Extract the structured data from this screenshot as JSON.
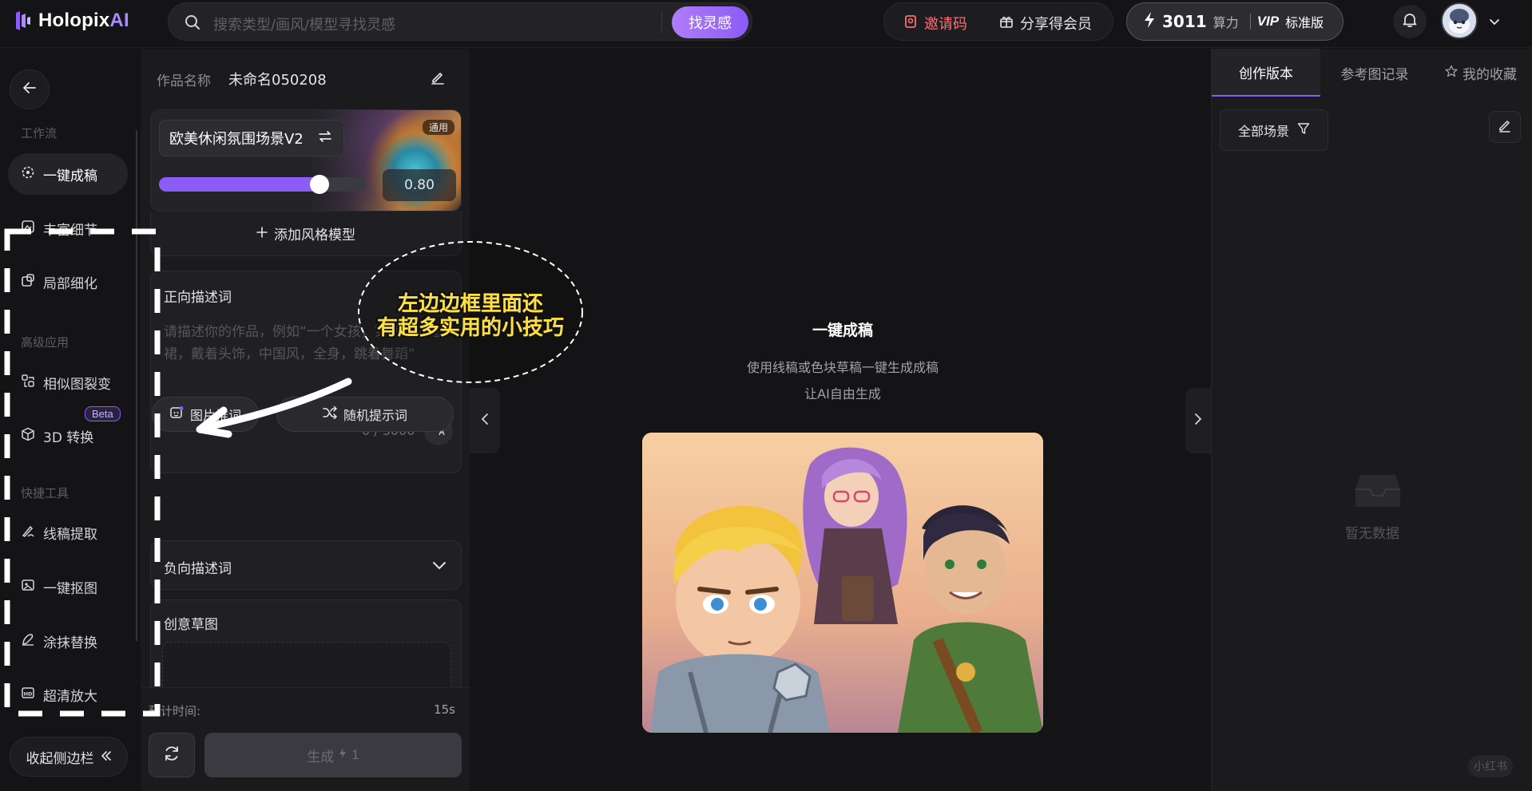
{
  "app": {
    "logo_text": "Holopix",
    "logo_ai": "AI"
  },
  "topbar": {
    "search_placeholder": "搜索类型/画风/模型寻找灵感",
    "search_button": "找灵感",
    "invite": "邀请码",
    "share": "分享得会员",
    "credits_value": "3011",
    "credits_unit": "算力",
    "vip_badge": "VIP",
    "vip_tier": "标准版"
  },
  "leftnav": {
    "sections": {
      "workflow": "工作流",
      "advanced": "高级应用",
      "quick": "快捷工具"
    },
    "items": [
      {
        "label": "一键成稿",
        "icon": "sparkle-icon",
        "active": true
      },
      {
        "label": "丰富细节",
        "icon": "detail-icon",
        "active": false
      },
      {
        "label": "局部细化",
        "icon": "local-refine-icon",
        "active": false
      },
      {
        "label": "相似图裂变",
        "icon": "similar-image-icon",
        "active": false
      },
      {
        "label": "3D 转换",
        "icon": "cube-icon",
        "active": false
      },
      {
        "label": "线稿提取",
        "icon": "pen-line-icon",
        "active": false
      },
      {
        "label": "一键抠图",
        "icon": "cutout-icon",
        "active": false
      },
      {
        "label": "涂抹替换",
        "icon": "smear-icon",
        "active": false
      },
      {
        "label": "超清放大",
        "icon": "hd-icon",
        "active": false
      }
    ],
    "beta_badge": "Beta",
    "collapse_label": "收起侧边栏"
  },
  "panel": {
    "work_label": "作品名称",
    "work_name": "未命名050208",
    "style_model": "欧美休闲氛围场景V2",
    "style_tag": "通用",
    "style_strength": 0.8,
    "style_strength_text": "0.80",
    "add_style": "添加风格模型",
    "prompt_title": "正向描述词",
    "prompt_placeholder": "请描述你的作品，例如“一个女孩，穿着红色短裙，戴着头饰，中国风，全身，跳着舞蹈”",
    "prompt_count": "0 / 3000",
    "btn_image_prompt": "图片推词",
    "btn_random_prompt": "随机提示词",
    "negative_title": "负向描述词",
    "sketch_title": "创意草图",
    "estimate_label": "预计时间:",
    "estimate_value": "15s",
    "generate_label": "生成",
    "generate_cost": "1"
  },
  "center": {
    "title": "一键成稿",
    "desc1": "使用线稿或色块草稿一键生成成稿",
    "desc2": "让AI自由生成"
  },
  "right": {
    "tabs": [
      "创作版本",
      "参考图记录",
      "我的收藏"
    ],
    "filter_label": "全部场景",
    "empty_text": "暂无数据"
  },
  "overlay": {
    "caption_line1": "左边边框里面还",
    "caption_line2": "有超多实用的小技巧",
    "watermark": "小红书"
  },
  "colors": {
    "accent": "#8b5cf6",
    "caption": "#fde047",
    "invite": "#f87171"
  }
}
